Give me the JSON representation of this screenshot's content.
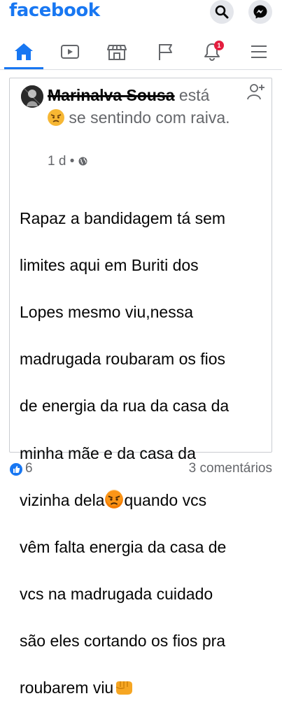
{
  "header": {
    "logo": "facebook",
    "icons": [
      "search-icon",
      "messenger-icon"
    ]
  },
  "nav": {
    "items": [
      "home-icon",
      "watch-icon",
      "marketplace-icon",
      "pages-flag-icon",
      "notifications-bell-icon",
      "menu-icon"
    ],
    "notification_count": "1",
    "active": "home-icon"
  },
  "post": {
    "author": "Marinalva Sousa",
    "feeling_prefix": "está",
    "feeling_text": "se sentindo com raiva.",
    "time": "1 d",
    "separator": "•",
    "privacy_icon": "globe-icon",
    "body_line_1": "Rapaz a bandidagem tá sem",
    "body_line_2": "limites aqui em Buriti dos",
    "body_line_3": "Lopes mesmo viu,nessa",
    "body_line_4": "madrugada roubaram os fios",
    "body_line_5": "de energia da rua da casa da",
    "body_line_6": "minha mãe e da casa da",
    "body_line_7a": "vizinha dela",
    "body_line_7b": "quando vcs",
    "body_line_8": "vêm falta energia da casa de",
    "body_line_9": "vcs na madrugada cuidado",
    "body_line_10": "são eles cortando os fios pra",
    "body_line_11": "roubarem viu"
  },
  "footer": {
    "reactions_count": "6",
    "comments": "3 comentários"
  },
  "colors": {
    "brand": "#1877f2",
    "badge": "#e41e3f"
  }
}
